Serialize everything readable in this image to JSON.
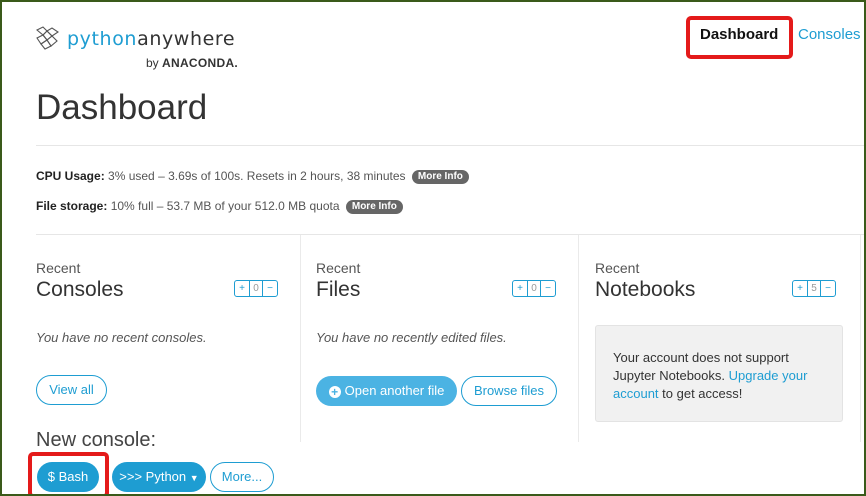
{
  "brand": {
    "python": "python",
    "anywhere": "anywhere",
    "by": "by",
    "anaconda": "ANACONDA."
  },
  "nav": {
    "dashboard": "Dashboard",
    "consoles": "Consoles"
  },
  "page_title": "Dashboard",
  "cpu": {
    "label": "CPU Usage:",
    "text": "3% used – 3.69s of 100s. Resets in 2 hours, 38 minutes",
    "more": "More Info"
  },
  "storage": {
    "label": "File storage:",
    "text": "10% full – 53.7 MB of your 512.0 MB quota",
    "more": "More Info"
  },
  "panels": {
    "consoles": {
      "recent": "Recent",
      "title": "Consoles",
      "count": "0",
      "empty": "You have no recent consoles.",
      "view_all": "View all"
    },
    "files": {
      "recent": "Recent",
      "title": "Files",
      "count": "0",
      "empty": "You have no recently edited files.",
      "open_another": "Open another file",
      "browse": "Browse files"
    },
    "notebooks": {
      "recent": "Recent",
      "title": "Notebooks",
      "count": "5",
      "msg_1": "Your account does not support Jupyter Notebooks.",
      "msg_link": "Upgrade your account",
      "msg_2": "to get access!"
    }
  },
  "counter_plus": "+",
  "counter_minus": "−",
  "new_console": {
    "label": "New console:",
    "bash": "$ Bash",
    "python": ">>> Python",
    "more": "More..."
  },
  "colors": {
    "accent": "#1e9dd2",
    "highlight": "#e41a1a",
    "info_box": "#f1f1f1"
  }
}
